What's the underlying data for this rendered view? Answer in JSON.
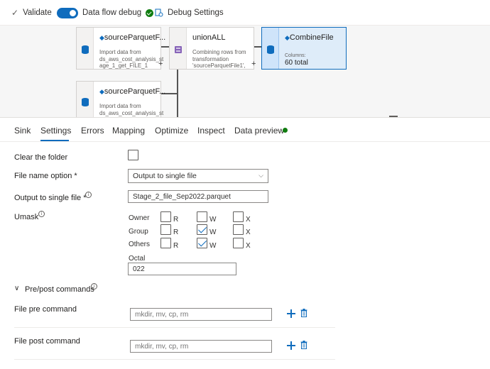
{
  "toolbar": {
    "validate": "Validate",
    "debug": "Data flow debug",
    "debug_settings": "Debug Settings"
  },
  "nodes": {
    "source1": {
      "title": "sourceParquetF...",
      "desc": "Import data from ds_aws_cost_analysis_st age_1_get_FILE_1"
    },
    "union": {
      "title": "unionALL",
      "desc": "Combining rows from transformation 'sourceParquetFile1',"
    },
    "sink": {
      "title": "CombineFile",
      "columns_label": "Columns:",
      "columns_value": "60 total"
    },
    "source2": {
      "title": "sourceParquetF...",
      "desc": "Import data from ds_aws_cost_analysis_st"
    }
  },
  "tabs": [
    "Sink",
    "Settings",
    "Errors",
    "Mapping",
    "Optimize",
    "Inspect",
    "Data preview"
  ],
  "form": {
    "clear_folder": "Clear the folder",
    "file_name_option": "File name option *",
    "file_name_option_value": "Output to single file",
    "output_single_file": "Output to single file *",
    "output_single_file_value": "Stage_2_file_Sep2022.parquet",
    "umask": "Umask",
    "rows": [
      "Owner",
      "Group",
      "Others"
    ],
    "perm_r": "R",
    "perm_w": "W",
    "perm_x": "X",
    "octal": "Octal",
    "octal_value": "022",
    "prepost": "Pre/post commands",
    "pre_command": "File pre command",
    "pre_placeholder": "mkdir, mv, cp, rm",
    "post_command": "File post command",
    "post_placeholder": "mkdir, mv, cp, rm"
  },
  "colors": {
    "accent": "#0f6cbd",
    "success": "#107c10"
  }
}
